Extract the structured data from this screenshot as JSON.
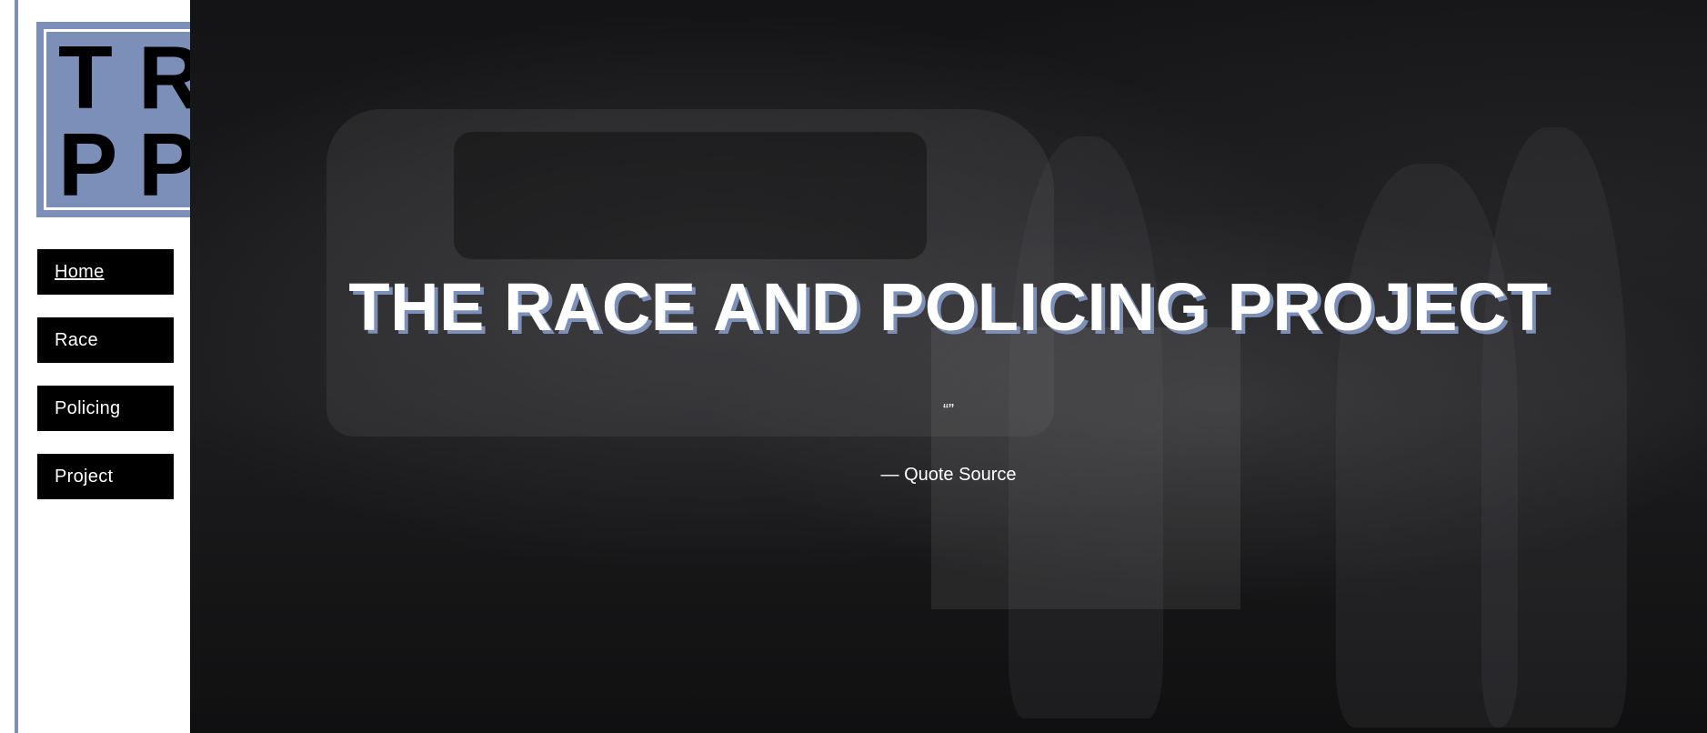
{
  "logo": {
    "letters": [
      "T",
      "R",
      "P",
      "P"
    ]
  },
  "nav": {
    "items": [
      {
        "label": "Home",
        "active": true
      },
      {
        "label": "Race",
        "active": false
      },
      {
        "label": "Policing",
        "active": false
      },
      {
        "label": "Project",
        "active": false
      }
    ]
  },
  "hero": {
    "title": "THE RACE AND POLICING PROJECT",
    "quote": "“”",
    "source": "— Quote Source"
  },
  "colors": {
    "accent": "#7b8fb8",
    "nav_bg": "#000000",
    "nav_text": "#ffffff",
    "hero_text": "#ffffff"
  }
}
